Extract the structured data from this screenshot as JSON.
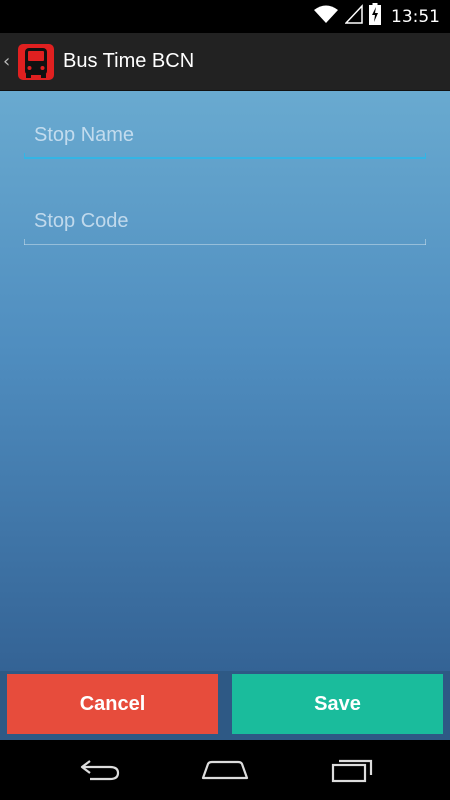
{
  "status_bar": {
    "time": "13:51",
    "icons": [
      "wifi-icon",
      "cell-signal-icon",
      "battery-charging-icon"
    ]
  },
  "action_bar": {
    "title": "Bus Time BCN",
    "app_icon": "bus-icon",
    "up_icon": "chevron-left-icon"
  },
  "form": {
    "stop_name": {
      "value": "",
      "placeholder": "Stop Name"
    },
    "stop_code": {
      "value": "",
      "placeholder": "Stop Code"
    }
  },
  "buttons": {
    "cancel_label": "Cancel",
    "save_label": "Save"
  },
  "nav_bar": {
    "icons": [
      "back-icon",
      "home-icon",
      "recent-apps-icon"
    ]
  },
  "colors": {
    "accent": "#33b5e5",
    "cancel": "#e74c3c",
    "save": "#1abc9c",
    "gradient_top": "#69aad0",
    "gradient_bottom": "#346395"
  }
}
